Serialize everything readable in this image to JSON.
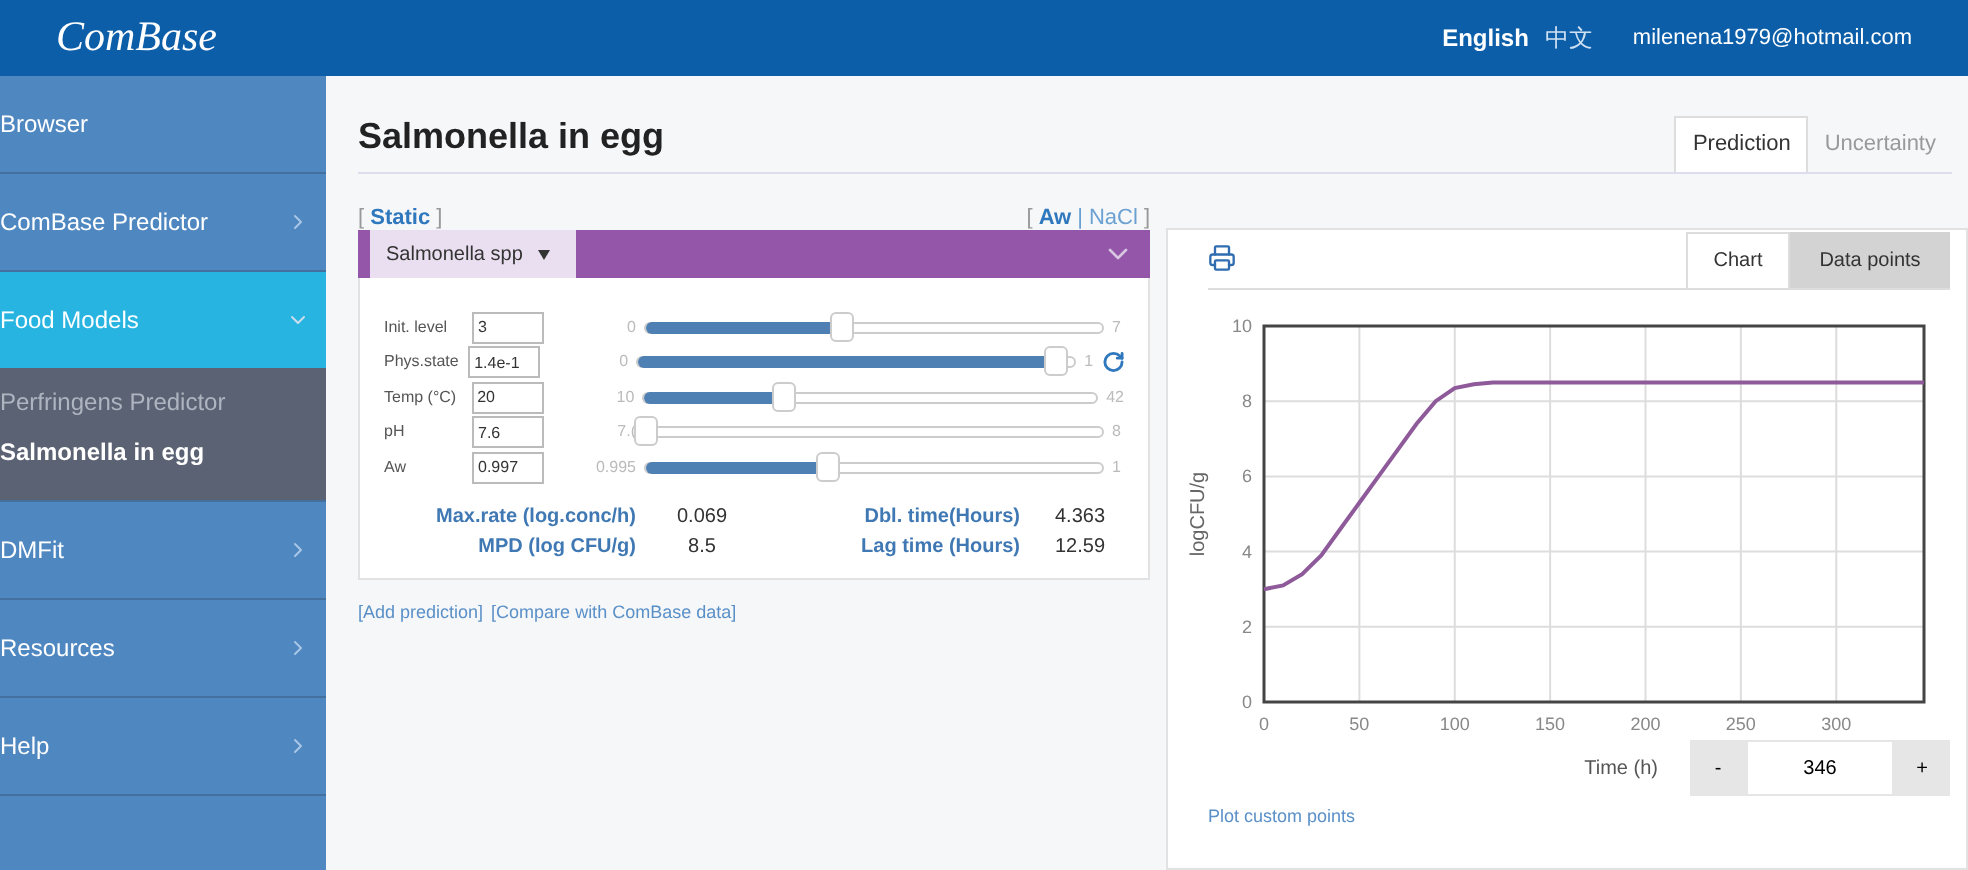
{
  "header": {
    "logo": "ComBase",
    "languages": [
      {
        "label": "English",
        "selected": true
      },
      {
        "label": "中文",
        "selected": false
      }
    ],
    "user": "milenena1979@hotmail.com"
  },
  "sidebar": {
    "items": [
      {
        "label": "Browser",
        "selected": false
      },
      {
        "label": "ComBase Predictor",
        "selected": false,
        "expanded": false
      },
      {
        "label": "Food Models",
        "selected": true,
        "expanded": true,
        "children": [
          {
            "label": "Perfringens Predictor",
            "selected": false
          },
          {
            "label": "Salmonella in egg",
            "selected": true
          }
        ]
      },
      {
        "label": "DMFit",
        "selected": false,
        "expanded": false
      },
      {
        "label": "Resources",
        "selected": false,
        "expanded": false
      },
      {
        "label": "Help",
        "selected": false,
        "expanded": false
      }
    ]
  },
  "page": {
    "title": "Salmonella in egg",
    "view_tabs": [
      {
        "label": "Prediction",
        "selected": true
      },
      {
        "label": "Uncertainty",
        "selected": false
      }
    ]
  },
  "model": {
    "mode": "[ **Static** ]",
    "factor_switch": {
      "open": "[",
      "separator": "|",
      "close": "]",
      "options": [
        {
          "label": "Aw",
          "selected": true
        },
        {
          "label": "NaCl",
          "selected": false
        }
      ]
    },
    "organism": "Salmonella spp",
    "parameters": [
      {
        "label": "Init. level",
        "value": "3",
        "min": "0",
        "max": "7",
        "level": 0.43,
        "resettable": false
      },
      {
        "label": "Phys.state",
        "value": "1.4e-1",
        "min": "0",
        "max": "1",
        "level": 0.96,
        "resettable": true
      },
      {
        "label": "Temp (°C)",
        "value": "20",
        "min": "10",
        "max": "42",
        "level": 0.31,
        "resettable": false
      },
      {
        "label": "pH",
        "value": "7.6",
        "min": "7.(",
        "max": "8",
        "level": 0,
        "resettable": false
      },
      {
        "label": "Aw",
        "value": "0.997",
        "min": "0.995",
        "max": "1",
        "level": 0.4,
        "resettable": false
      }
    ],
    "results": [
      {
        "label": "Max.rate (log.conc/h)",
        "value": "0.069"
      },
      {
        "label": "Dbl. time(Hours)",
        "value": "4.363"
      },
      {
        "label": "MPD (log CFU/g)",
        "value": "8.5"
      },
      {
        "label": "Lag time (Hours)",
        "value": "12.59"
      }
    ],
    "links": [
      "[Add prediction]",
      "[Compare with ComBase data]"
    ]
  },
  "output": {
    "chart_tabs": [
      {
        "label": "Chart",
        "selected": true
      },
      {
        "label": "Data points",
        "selected": false
      }
    ],
    "chart_data": {
      "type": "line",
      "grid": true,
      "ylabel": "logCFU/g",
      "xlim": [
        0,
        346
      ],
      "ylim": [
        0,
        10
      ],
      "xticks": [
        0,
        50,
        100,
        150,
        200,
        250,
        300
      ],
      "yticks": [
        0,
        2,
        4,
        6,
        8,
        10
      ],
      "x": [
        0,
        10,
        20,
        30,
        40,
        50,
        60,
        70,
        80,
        90,
        100,
        110,
        120,
        150,
        200,
        250,
        300,
        346
      ],
      "series": [
        {
          "color": "#8e5a9a",
          "values": [
            3.0,
            3.1,
            3.4,
            3.9,
            4.6,
            5.3,
            6.0,
            6.7,
            7.4,
            8.0,
            8.35,
            8.45,
            8.5,
            8.5,
            8.5,
            8.5,
            8.5,
            8.5
          ]
        }
      ]
    },
    "time_control": {
      "label": "Time (h)",
      "decrement": "-",
      "value": "346",
      "increment": "+"
    },
    "plot_link": "Plot custom points"
  }
}
